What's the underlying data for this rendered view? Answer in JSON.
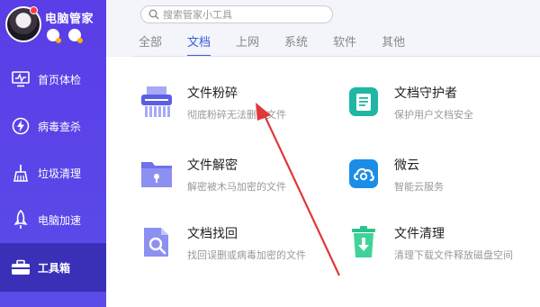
{
  "profile": {
    "name": "电脑管家"
  },
  "sidebar": {
    "items": [
      {
        "label": "首页体检",
        "icon": "monitor-check-icon"
      },
      {
        "label": "病毒查杀",
        "icon": "lightning-shield-icon"
      },
      {
        "label": "垃圾清理",
        "icon": "broom-icon"
      },
      {
        "label": "电脑加速",
        "icon": "rocket-icon"
      },
      {
        "label": "工具箱",
        "icon": "toolbox-icon",
        "active": true
      }
    ]
  },
  "search": {
    "placeholder": "搜索管家小工具"
  },
  "tabs": [
    {
      "label": "全部"
    },
    {
      "label": "文档",
      "active": true
    },
    {
      "label": "上网"
    },
    {
      "label": "系统"
    },
    {
      "label": "软件"
    },
    {
      "label": "其他"
    }
  ],
  "tools": [
    {
      "title": "文件粉碎",
      "desc": "彻底粉碎无法删除文件",
      "icon": "shredder-icon"
    },
    {
      "title": "文档守护者",
      "desc": "保护用户文档安全",
      "icon": "document-guard-icon"
    },
    {
      "title": "文件解密",
      "desc": "解密被木马加密的文件",
      "icon": "folder-lock-icon"
    },
    {
      "title": "微云",
      "desc": "智能云服务",
      "icon": "cloud-icon"
    },
    {
      "title": "文档找回",
      "desc": "找回误删或病毒加密的文件",
      "icon": "document-search-icon"
    },
    {
      "title": "文件清理",
      "desc": "清理下载文件释放磁盘空间",
      "icon": "trash-download-icon"
    }
  ],
  "colors": {
    "sidebar": "#5a3de6",
    "sidebar_active": "#3a30b8",
    "accent": "#3a5bd8",
    "arrow": "#e0373a"
  }
}
